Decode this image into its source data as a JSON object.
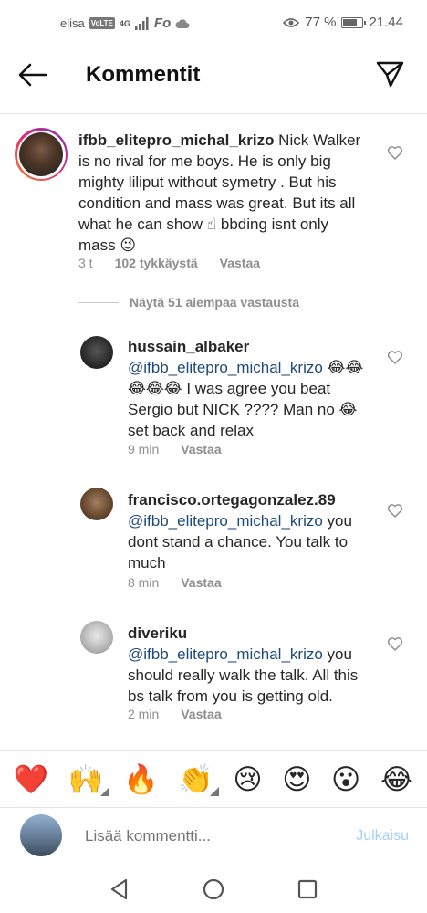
{
  "status_bar": {
    "carrier": "elisa",
    "volte_badge": "VoLTE",
    "network": "4G",
    "app_badge": "Fo",
    "battery_percent": "77 %",
    "battery_level": 0.77,
    "time": "21.44"
  },
  "header": {
    "title": "Kommentit",
    "back_icon": "arrow-left-icon",
    "send_icon": "paper-plane-icon"
  },
  "main_comment": {
    "username": "ifbb_elitepro_michal_krizo",
    "text": " Nick Walker is no rival for me boys. He is only big mighty liliput without symetry . But his condition and mass was great. But its all what he can show ☝ bbding isnt only mass 😉",
    "time": "3 t",
    "likes": "102 tykkäystä",
    "reply": "Vastaa"
  },
  "view_replies": "Näytä 51 aiempaa vastausta",
  "replies": [
    {
      "username": "hussain_albaker",
      "mention": "@ifbb_elitepro_michal_krizo",
      "text": " 😂😂😂😂😂 I was agree you beat Sergio but NICK ???? Man no 😂 set back and relax",
      "time": "9 min",
      "reply": "Vastaa"
    },
    {
      "username": "francisco.ortegagonzalez.89",
      "mention": "@ifbb_elitepro_michal_krizo",
      "text": " you dont stand a chance. You talk to much",
      "time": "8 min",
      "reply": "Vastaa"
    },
    {
      "username": "diveriku",
      "mention": "@ifbb_elitepro_michal_krizo",
      "text": " you should really walk the talk. All this bs talk from you is getting old.",
      "time": "2 min",
      "reply": "Vastaa"
    }
  ],
  "emoji_bar": [
    "❤️",
    "🙌",
    "🔥",
    "👏",
    "😢",
    "😍",
    "😮",
    "😂"
  ],
  "add_comment": {
    "placeholder": "Lisää kommentti...",
    "publish": "Julkaisu"
  },
  "colors": {
    "mention": "#1d4a7a",
    "secondary_text": "#8e8e8e",
    "publish_disabled": "#a6d1f5",
    "story_ring_start": "#f58529",
    "story_ring_end": "#dd2a7b"
  }
}
